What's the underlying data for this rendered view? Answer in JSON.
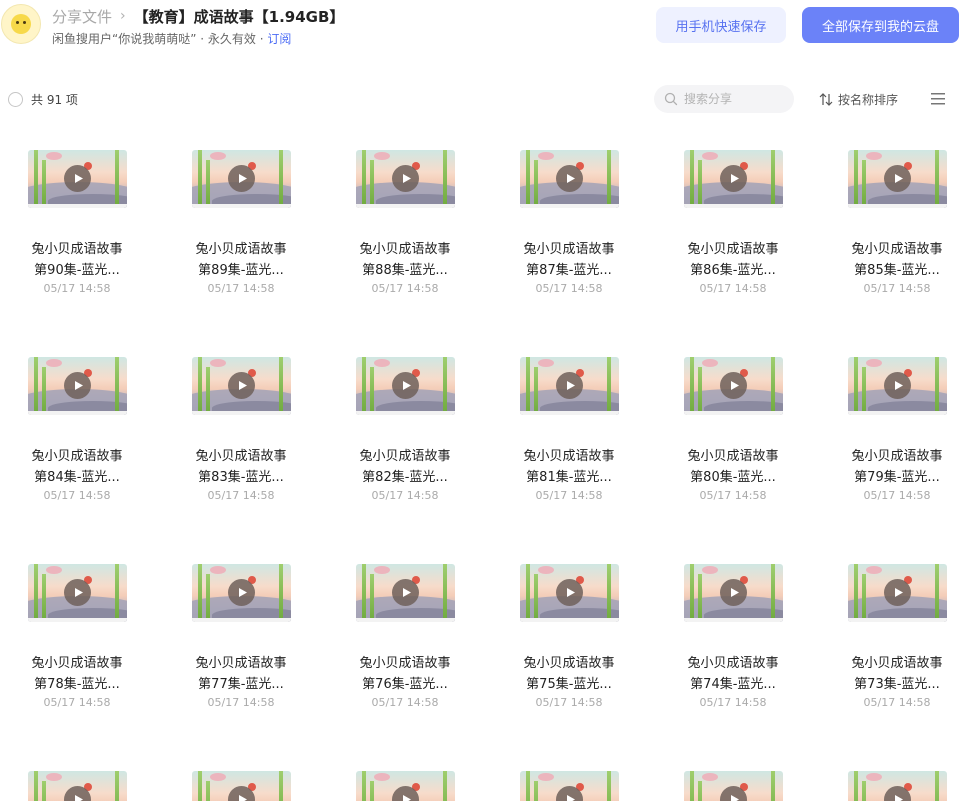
{
  "header": {
    "breadcrumb_root": "分享文件",
    "breadcrumb_sep": "›",
    "title": "【教育】成语故事【1.94GB】",
    "sharer_text": "闲鱼搜用户“你说我萌萌哒” · 永久有效 · ",
    "subscribe": "订阅",
    "quick_save": "用手机快速保存",
    "save_all": "全部保存到我的云盘"
  },
  "toolbar": {
    "count": "共 91 项",
    "search_placeholder": "搜索分享",
    "sort": "按名称排序"
  },
  "files": [
    {
      "line1": "兔小贝成语故事",
      "line2": "第90集-蓝光...",
      "date": "05/17 14:58"
    },
    {
      "line1": "兔小贝成语故事",
      "line2": "第89集-蓝光...",
      "date": "05/17 14:58"
    },
    {
      "line1": "兔小贝成语故事",
      "line2": "第88集-蓝光...",
      "date": "05/17 14:58"
    },
    {
      "line1": "兔小贝成语故事",
      "line2": "第87集-蓝光...",
      "date": "05/17 14:58"
    },
    {
      "line1": "兔小贝成语故事",
      "line2": "第86集-蓝光...",
      "date": "05/17 14:58"
    },
    {
      "line1": "兔小贝成语故事",
      "line2": "第85集-蓝光...",
      "date": "05/17 14:58"
    },
    {
      "line1": "兔小贝成语故事",
      "line2": "第84集-蓝光...",
      "date": "05/17 14:58"
    },
    {
      "line1": "兔小贝成语故事",
      "line2": "第83集-蓝光...",
      "date": "05/17 14:58"
    },
    {
      "line1": "兔小贝成语故事",
      "line2": "第82集-蓝光...",
      "date": "05/17 14:58"
    },
    {
      "line1": "兔小贝成语故事",
      "line2": "第81集-蓝光...",
      "date": "05/17 14:58"
    },
    {
      "line1": "兔小贝成语故事",
      "line2": "第80集-蓝光...",
      "date": "05/17 14:58"
    },
    {
      "line1": "兔小贝成语故事",
      "line2": "第79集-蓝光...",
      "date": "05/17 14:58"
    },
    {
      "line1": "兔小贝成语故事",
      "line2": "第78集-蓝光...",
      "date": "05/17 14:58"
    },
    {
      "line1": "兔小贝成语故事",
      "line2": "第77集-蓝光...",
      "date": "05/17 14:58"
    },
    {
      "line1": "兔小贝成语故事",
      "line2": "第76集-蓝光...",
      "date": "05/17 14:58"
    },
    {
      "line1": "兔小贝成语故事",
      "line2": "第75集-蓝光...",
      "date": "05/17 14:58"
    },
    {
      "line1": "兔小贝成语故事",
      "line2": "第74集-蓝光...",
      "date": "05/17 14:58"
    },
    {
      "line1": "兔小贝成语故事",
      "line2": "第73集-蓝光...",
      "date": "05/17 14:58"
    }
  ],
  "partial_row_count": 6,
  "colors": {
    "accent": "#6b82f8",
    "accent_light": "#eef1ff",
    "link": "#4c6cf5"
  }
}
